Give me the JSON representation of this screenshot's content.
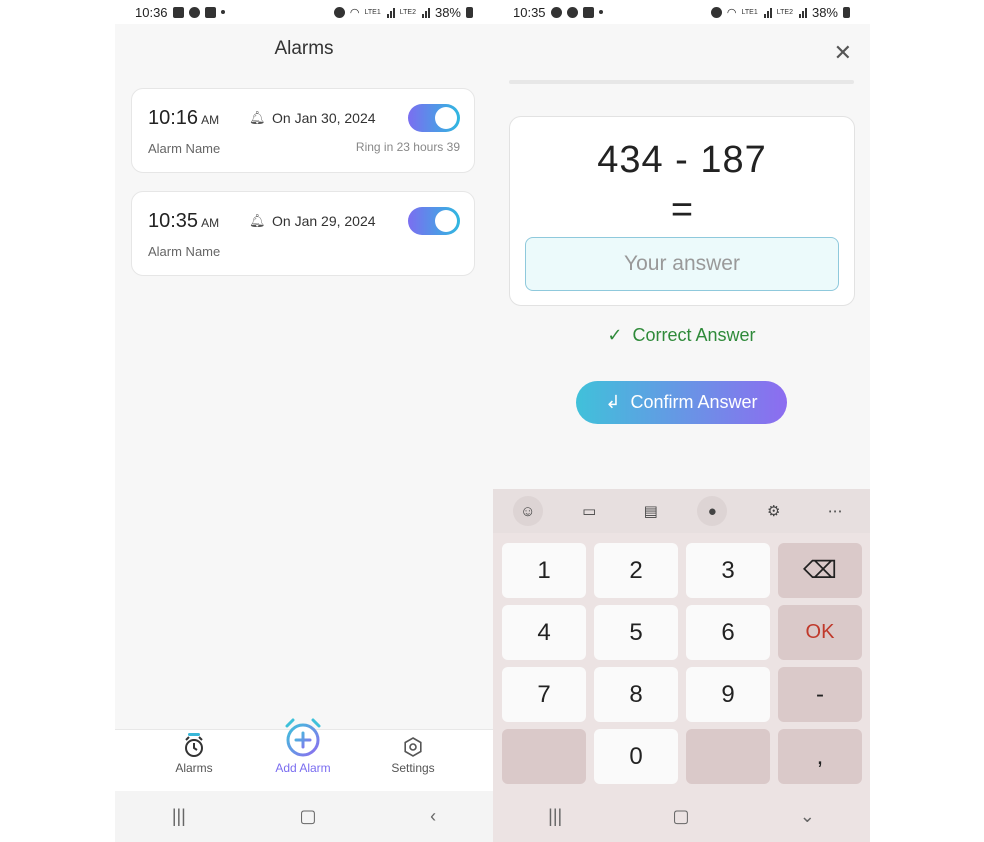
{
  "left": {
    "status": {
      "time": "10:36",
      "battery": "38%"
    },
    "title": "Alarms",
    "alarms": [
      {
        "time": "10:16",
        "ampm": "AM",
        "date": "On Jan 30, 2024",
        "name": "Alarm Name",
        "ring": "Ring in 23 hours 39",
        "enabled": true
      },
      {
        "time": "10:35",
        "ampm": "AM",
        "date": "On Jan 29, 2024",
        "name": "Alarm Name",
        "ring": "",
        "enabled": true
      }
    ],
    "nav": {
      "alarms": "Alarms",
      "add": "Add Alarm",
      "settings": "Settings"
    }
  },
  "right": {
    "status": {
      "time": "10:35",
      "battery": "38%"
    },
    "question": "434 - 187",
    "equals": "=",
    "answer_placeholder": "Your answer",
    "feedback": "Correct Answer",
    "confirm_label": "Confirm Answer",
    "keys": {
      "k1": "1",
      "k2": "2",
      "k3": "3",
      "k4": "4",
      "k5": "5",
      "k6": "6",
      "k7": "7",
      "k8": "8",
      "k9": "9",
      "k0": "0",
      "ok": "OK",
      "minus": "-",
      "comma": ","
    }
  },
  "colors": {
    "accent": "#7a6df0",
    "accent2": "#40c1da",
    "success": "#2f8a3a",
    "ok_key": "#c0392b"
  }
}
